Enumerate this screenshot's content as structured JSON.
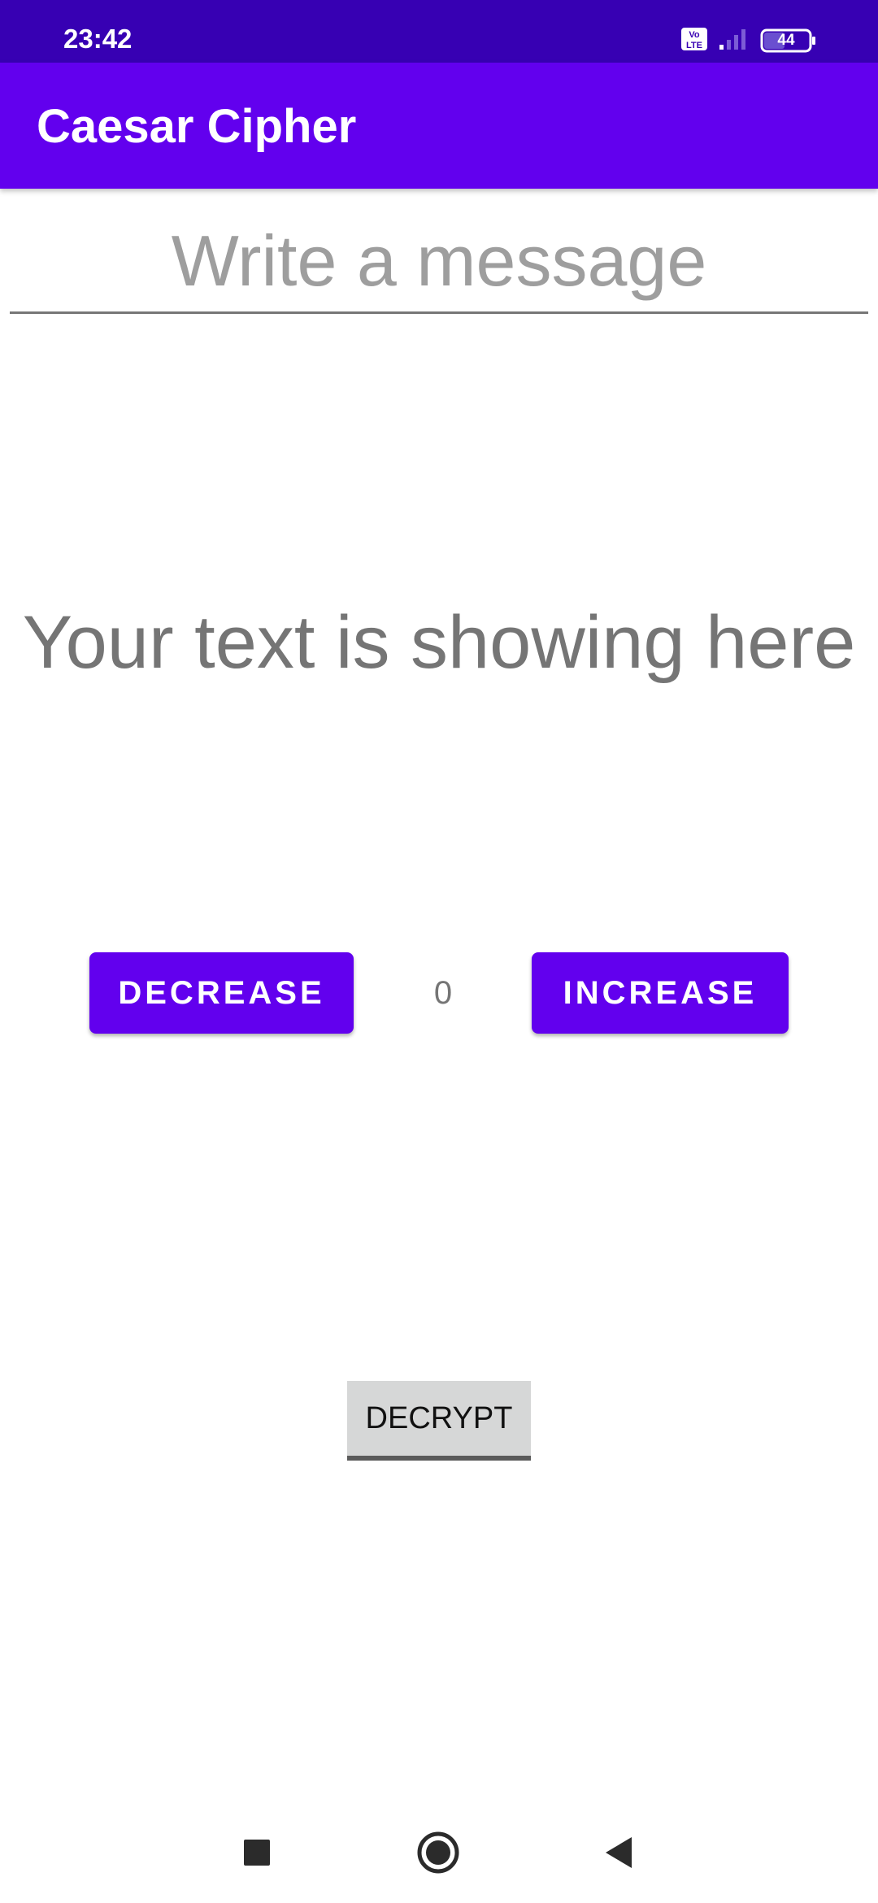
{
  "status_bar": {
    "time": "23:42",
    "icons": [
      "volte-icon",
      "signal-icon",
      "battery-icon"
    ],
    "battery_level": "44"
  },
  "app_bar": {
    "title": "Caesar Cipher"
  },
  "message_input": {
    "value": "",
    "placeholder": "Write a message"
  },
  "output": {
    "text": "Your text is showing here"
  },
  "shift_controls": {
    "decrease_label": "DECREASE",
    "value": "0",
    "increase_label": "INCREASE"
  },
  "decrypt_button": {
    "label": "DECRYPT"
  },
  "nav_bar": {
    "icons": [
      "recents-icon",
      "home-icon",
      "back-icon"
    ]
  },
  "colors": {
    "status_bar": "#3700b3",
    "primary": "#6200ee",
    "text_secondary": "#757575",
    "button_gray": "#d6d7d7"
  }
}
